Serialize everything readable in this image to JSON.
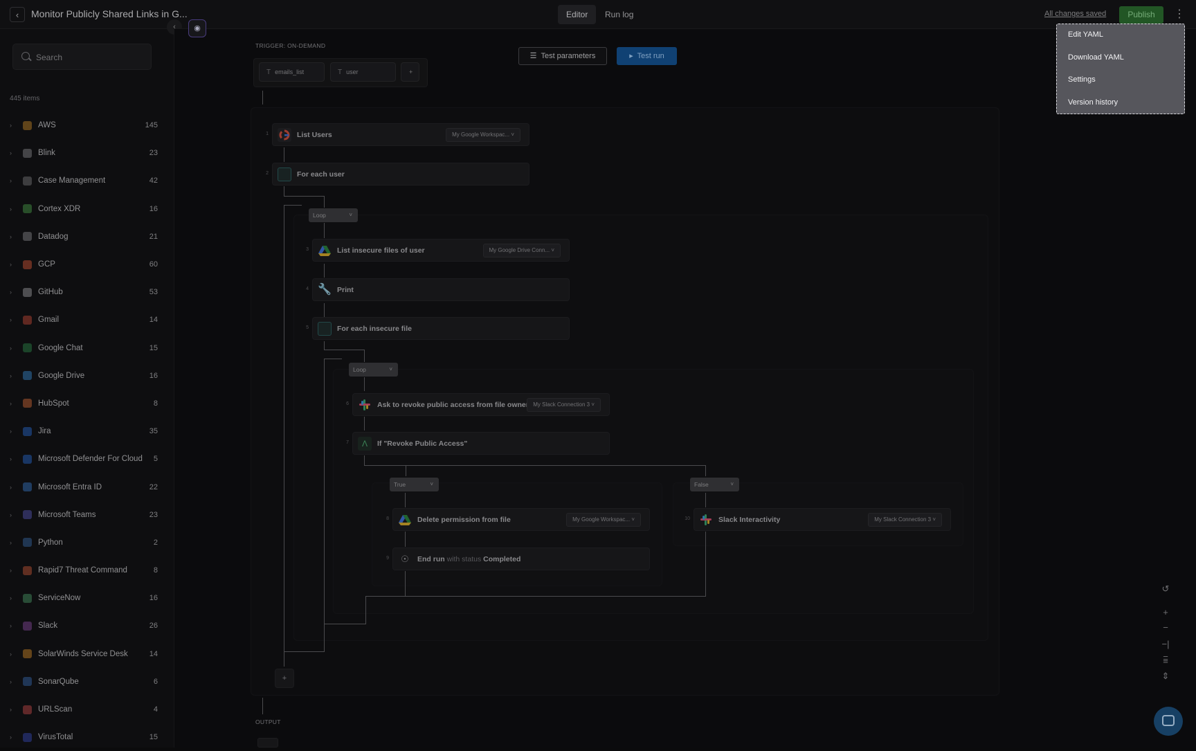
{
  "header": {
    "title": "Monitor Publicly Shared Links in G...",
    "tabs": [
      "Editor",
      "Run log"
    ],
    "saved_status": "All changes saved",
    "publish_label": "Publish"
  },
  "sidebar": {
    "search_placeholder": "Search",
    "item_count": "445 items",
    "items": [
      {
        "name": "AWS",
        "count": "145",
        "color": "#c98a2a"
      },
      {
        "name": "Blink",
        "count": "23",
        "color": "#8a8a8e"
      },
      {
        "name": "Case Management",
        "count": "42",
        "color": "#7a7a7e"
      },
      {
        "name": "Cortex XDR",
        "count": "16",
        "color": "#4aa04a"
      },
      {
        "name": "Datadog",
        "count": "21",
        "color": "#8a8a8e"
      },
      {
        "name": "GCP",
        "count": "60",
        "color": "#d65a3a"
      },
      {
        "name": "GitHub",
        "count": "53",
        "color": "#a0a0a4"
      },
      {
        "name": "Gmail",
        "count": "14",
        "color": "#c84a3a"
      },
      {
        "name": "Google Chat",
        "count": "15",
        "color": "#2e8a4a"
      },
      {
        "name": "Google Drive",
        "count": "16",
        "color": "#3a8ad0"
      },
      {
        "name": "HubSpot",
        "count": "8",
        "color": "#d06a3a"
      },
      {
        "name": "Jira",
        "count": "35",
        "color": "#2a6ad0"
      },
      {
        "name": "Microsoft Defender For Cloud",
        "count": "5",
        "color": "#2a6ad0"
      },
      {
        "name": "Microsoft Entra ID",
        "count": "22",
        "color": "#3a7ac8"
      },
      {
        "name": "Microsoft Teams",
        "count": "23",
        "color": "#5a5ab8"
      },
      {
        "name": "Python",
        "count": "2",
        "color": "#3a6aa8"
      },
      {
        "name": "Rapid7 Threat Command",
        "count": "8",
        "color": "#c85a3a"
      },
      {
        "name": "ServiceNow",
        "count": "16",
        "color": "#4a9a6a"
      },
      {
        "name": "Slack",
        "count": "26",
        "color": "#8a4aa0"
      },
      {
        "name": "SolarWinds Service Desk",
        "count": "14",
        "color": "#d08a2a"
      },
      {
        "name": "SonarQube",
        "count": "6",
        "color": "#3a6ab0"
      },
      {
        "name": "URLScan",
        "count": "4",
        "color": "#c84a4a"
      },
      {
        "name": "VirusTotal",
        "count": "15",
        "color": "#3a4ab8"
      }
    ]
  },
  "canvas": {
    "trigger_label": "TRIGGER: ON-DEMAND",
    "params": [
      "emails_list",
      "user"
    ],
    "add_param": "+",
    "test_params_label": "Test parameters",
    "test_run_label": "Test run",
    "output_label": "OUTPUT",
    "add_step": "+",
    "steps": [
      {
        "num": "1",
        "title": "List Users",
        "connection": "My Google Workspac..."
      },
      {
        "num": "2",
        "title": "For each user"
      },
      {
        "num": "3",
        "title": "List insecure files of user",
        "connection": "My Google Drive Conn..."
      },
      {
        "num": "4",
        "title": "Print"
      },
      {
        "num": "5",
        "title": "For each insecure file"
      },
      {
        "num": "6",
        "title": "Ask to revoke public access from file owner",
        "connection": "My Slack Connection 3"
      },
      {
        "num": "7",
        "title": "If \"Revoke Public Access\""
      },
      {
        "num": "8",
        "title": "Delete permission from file",
        "connection": "My Google Workspac..."
      },
      {
        "num": "9",
        "title_a": "End run",
        "title_b": "with status",
        "title_c": "Completed"
      },
      {
        "num": "10",
        "title": "Slack Interactivity",
        "connection": "My Slack Connection 3"
      }
    ],
    "pills": {
      "loop": "Loop",
      "true": "True",
      "false": "False"
    }
  },
  "menu": {
    "items": [
      "Edit YAML",
      "Download YAML",
      "Settings",
      "Version history"
    ]
  },
  "icons": {
    "back": "chevron-left-icon",
    "search": "search-icon",
    "kebab": "more-vertical-icon",
    "chat": "chat-icon"
  }
}
